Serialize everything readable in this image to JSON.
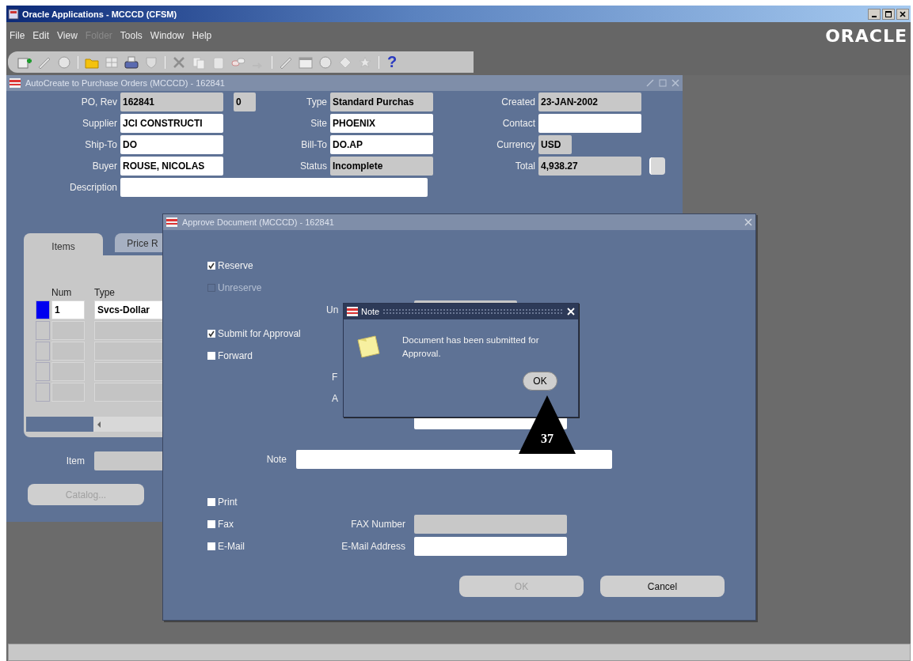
{
  "window": {
    "title": "Oracle Applications - MCCCD (CFSM)"
  },
  "menu": [
    {
      "label": "File",
      "disabled": false
    },
    {
      "label": "Edit",
      "disabled": false
    },
    {
      "label": "View",
      "disabled": false
    },
    {
      "label": "Folder",
      "disabled": true
    },
    {
      "label": "Tools",
      "disabled": false
    },
    {
      "label": "Window",
      "disabled": false
    },
    {
      "label": "Help",
      "disabled": false
    }
  ],
  "logo": "ORACLE",
  "toolbar": {
    "help": "?"
  },
  "po_window": {
    "title": "AutoCreate to Purchase Orders (MCCCD) - 162841",
    "rows": [
      {
        "left": {
          "label": "PO, Rev",
          "value": "162841",
          "editable": false
        },
        "rev": {
          "value": "0",
          "editable": false
        },
        "middle": {
          "label": "Type",
          "value": "Standard Purchas",
          "editable": false
        },
        "right": {
          "label": "Created",
          "value": "23-JAN-2002",
          "editable": false
        }
      },
      {
        "left": {
          "label": "Supplier",
          "value": "JCI CONSTRUCTI",
          "editable": true
        },
        "middle": {
          "label": "Site",
          "value": "PHOENIX",
          "editable": true
        },
        "right": {
          "label": "Contact",
          "editable": true
        }
      },
      {
        "left": {
          "label": "Ship-To",
          "value": "DO",
          "editable": true
        },
        "middle": {
          "label": "Bill-To",
          "value": "DO.AP",
          "editable": true
        },
        "right": {
          "label": "Currency",
          "value": "USD",
          "editable": false
        }
      },
      {
        "left": {
          "label": "Buyer",
          "value": "ROUSE, NICOLAS",
          "editable": true
        },
        "middle": {
          "label": "Status",
          "value": "Incomplete",
          "editable": false
        },
        "right": {
          "label": "Total",
          "value": "4,938.27",
          "editable": false
        }
      }
    ],
    "description": {
      "label": "Description",
      "editable": true
    },
    "tabs": [
      {
        "label": "Items",
        "selected": true
      },
      {
        "label": "Price R",
        "selected": false
      }
    ],
    "table": {
      "columns": [
        "Num",
        "Type"
      ],
      "rows": [
        {
          "selected": true,
          "num": "1",
          "type": "Svcs-Dollar"
        },
        {
          "selected": false
        },
        {
          "selected": false
        },
        {
          "selected": false
        },
        {
          "selected": false
        }
      ]
    },
    "item": {
      "label": "Item",
      "editable": false
    },
    "catalog_button": {
      "label": "Catalog...",
      "disabled": true
    }
  },
  "approve_dialog": {
    "title": "Approve Document (MCCCD) - 162841",
    "reserve_options": [
      {
        "label": "Reserve",
        "checked": true,
        "disabled": false
      },
      {
        "label": "Unreserve",
        "checked": false,
        "disabled": true
      }
    ],
    "covered_label": "Un",
    "submit_options": [
      {
        "label": "Submit for Approval",
        "checked": true,
        "disabled": false
      },
      {
        "label": "Forward",
        "checked": false,
        "disabled": false
      }
    ],
    "covered_labels": [
      "F",
      "A"
    ],
    "note": {
      "label": "Note"
    },
    "delivery_options": [
      {
        "label": "Print",
        "checked": false
      },
      {
        "label": "Fax",
        "checked": false,
        "field_label": "FAX Number",
        "field_disabled": true
      },
      {
        "label": "E-Mail",
        "checked": false,
        "field_label": "E-Mail Address",
        "field_disabled": false
      }
    ],
    "buttons": [
      {
        "label": "OK",
        "disabled": true
      },
      {
        "label": "Cancel",
        "disabled": false
      }
    ]
  },
  "note_dialog": {
    "title": "Note",
    "message": "Document has been submitted for Approval.",
    "button": "OK"
  },
  "callout": {
    "label": "37"
  }
}
